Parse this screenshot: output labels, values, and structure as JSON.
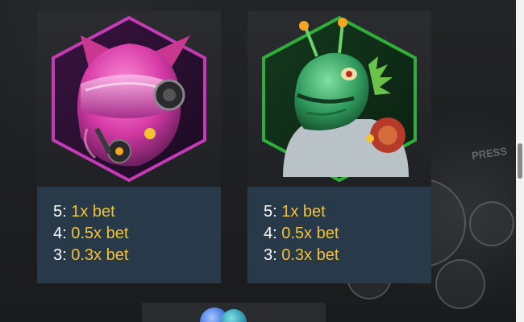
{
  "symbols": [
    {
      "name": "pink-cat-helmet-robot",
      "frame_color": "#c43bb5",
      "payouts": [
        {
          "count": "5:",
          "value": "1x bet"
        },
        {
          "count": "4:",
          "value": "0.5x bet"
        },
        {
          "count": "3:",
          "value": "0.3x bet"
        }
      ]
    },
    {
      "name": "green-alien-astronaut",
      "frame_color": "#2fae3c",
      "payouts": [
        {
          "count": "5:",
          "value": "1x bet"
        },
        {
          "count": "4:",
          "value": "0.5x bet"
        },
        {
          "count": "3:",
          "value": "0.3x bet"
        }
      ]
    }
  ],
  "colors": {
    "payout_panel": "#283a4a",
    "payout_count": "#ffffff",
    "payout_value": "#f4c233"
  }
}
